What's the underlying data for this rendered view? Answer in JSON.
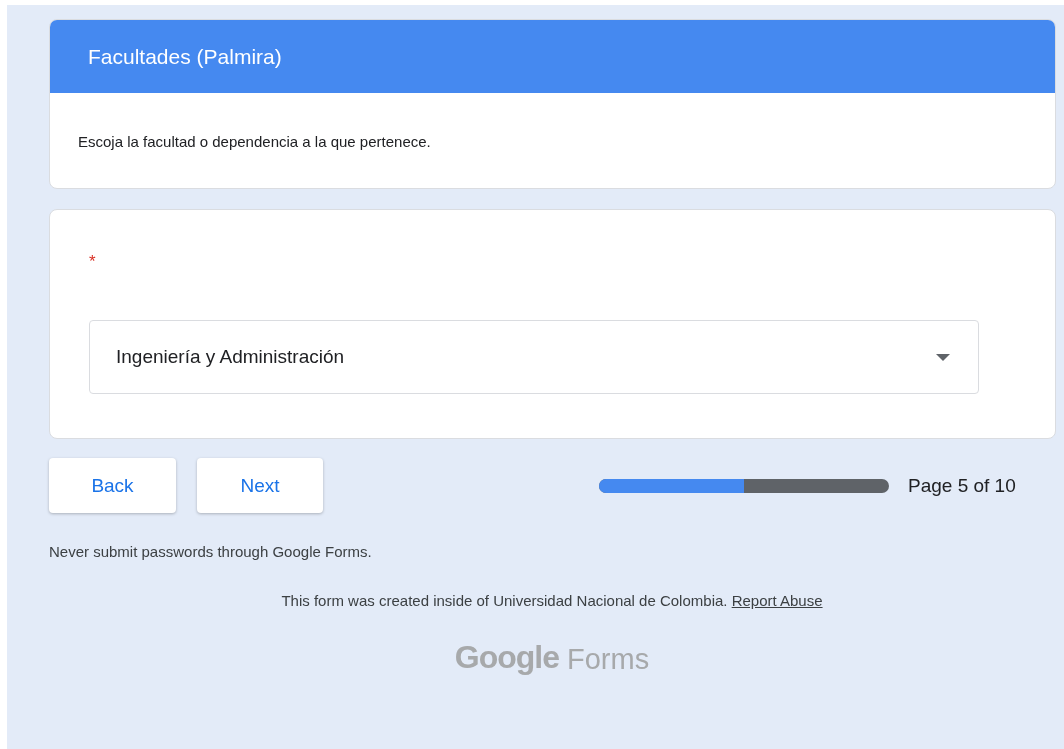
{
  "section": {
    "title": "Facultades (Palmira)",
    "description": "Escoja la facultad o dependencia a la que pertenece."
  },
  "question": {
    "required_mark": "*",
    "dropdown": {
      "value": "Ingeniería y Administración"
    }
  },
  "buttons": [
    {
      "label": "Back"
    },
    {
      "label": "Next"
    }
  ],
  "progress": {
    "level": 0.5,
    "label": "Page 5 of 10"
  },
  "warning": "Never submit passwords through Google Forms.",
  "footer": {
    "text": "This form was created inside of Universidad Nacional de Colombia.",
    "link": "Report Abuse"
  },
  "logo": {
    "brand": "Google",
    "product": "Forms"
  }
}
